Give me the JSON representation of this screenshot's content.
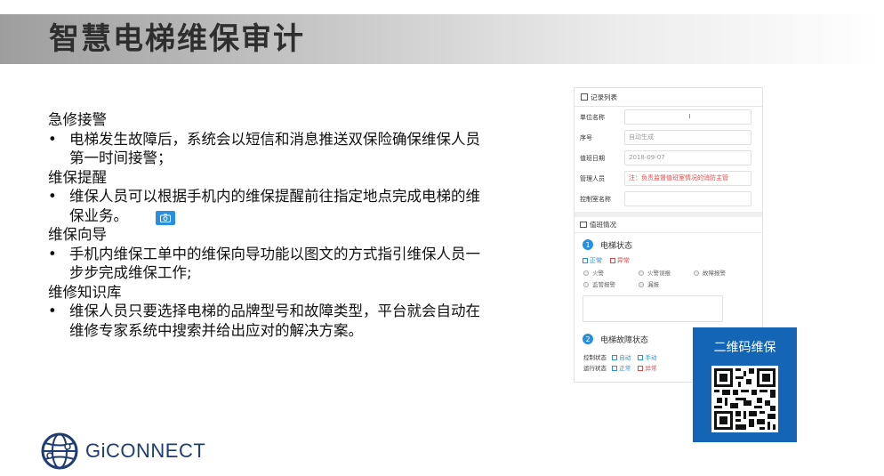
{
  "title": "智慧电梯维保审计",
  "sections": [
    {
      "heading": "急修接警",
      "bullet": "电梯发生故障后，系统会以短信和消息推送双保险确保维保人员第一时间接警；"
    },
    {
      "heading": "维保提醒",
      "bullet": "维保人员可以根据手机内的维保提醒前往指定地点完成电梯的维保业务。"
    },
    {
      "heading": "维保向导",
      "bullet": "手机内维保工单中的维保向导功能以图文的方式指引维保人员一步步完成维保工作;"
    },
    {
      "heading": "维修知识库",
      "bullet": "维保人员只要选择电梯的品牌型号和故障类型，平台就会自动在维修专家系统中搜索并给出应对的解决方案。"
    }
  ],
  "bullet_symbol": "•",
  "brand": {
    "name": "GiCONNECT",
    "color": "#1f3d72"
  },
  "form": {
    "header": "记录列表",
    "fields": [
      {
        "label": "单位名称",
        "value": "",
        "cursor": "I"
      },
      {
        "label": "序号",
        "value": "自动生成"
      },
      {
        "label": "值班日期",
        "value": "2018-09-07"
      },
      {
        "label": "管理人员",
        "value": "注：负责监督值班室情况的消防主管"
      },
      {
        "label": "控制室名称",
        "value": ""
      }
    ],
    "section_header": "值班情况",
    "step1": {
      "number": "1",
      "label": "电梯状态"
    },
    "status_options": {
      "normal": "正常",
      "abnormal": "异常"
    },
    "alarm_options": [
      "火警",
      "火警误报",
      "故障报警",
      "监管报警",
      "漏报"
    ],
    "step2": {
      "number": "2",
      "label": "电梯故障状态"
    },
    "control_status": {
      "label": "控制状态",
      "opt1": "自动",
      "opt2": "手动"
    },
    "run_status": {
      "label": "运行状态",
      "opt1": "正常",
      "opt2": "异常"
    }
  },
  "qr": {
    "label": "二维码维保"
  },
  "colors": {
    "accent": "#2b8fe0",
    "qr_bg": "#1565b6",
    "alert": "#e04848"
  }
}
